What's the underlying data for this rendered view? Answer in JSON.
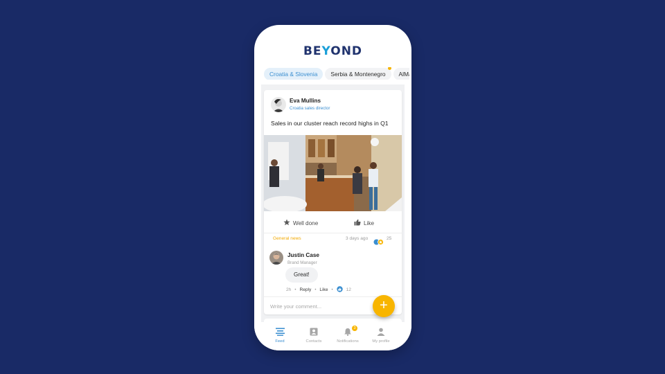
{
  "app": {
    "logo_pre": "BE",
    "logo_y": "Y",
    "logo_post": "OND",
    "brand_color": "#20336e",
    "accent_color": "#1a9fd8"
  },
  "tabs": [
    {
      "label": "Croatia & Slovenia",
      "active": true
    },
    {
      "label": "Serbia & Montenegro",
      "has_notification_dot": true
    },
    {
      "label": "AlMal"
    }
  ],
  "post": {
    "author": {
      "name": "Eva Mullins",
      "role": "Croatia sales director"
    },
    "text": "Sales in our cluster reach record highs in Q1",
    "actions": {
      "well_done": "Well done",
      "like": "Like"
    },
    "category": "General news",
    "time": "3 days ago",
    "reaction_count": "25",
    "comment": {
      "author": "Justin Case",
      "role": "Brand Manager",
      "text": "Great!",
      "time": "2h",
      "reply": "Reply",
      "like": "Like",
      "like_count": "12"
    },
    "comment_placeholder": "Write your comment..."
  },
  "fab": {
    "label": "+"
  },
  "nav": {
    "feed": "Feed",
    "contacts": "Contacts",
    "notifications": "Notifications",
    "notifications_badge": "3",
    "profile": "My profile"
  }
}
